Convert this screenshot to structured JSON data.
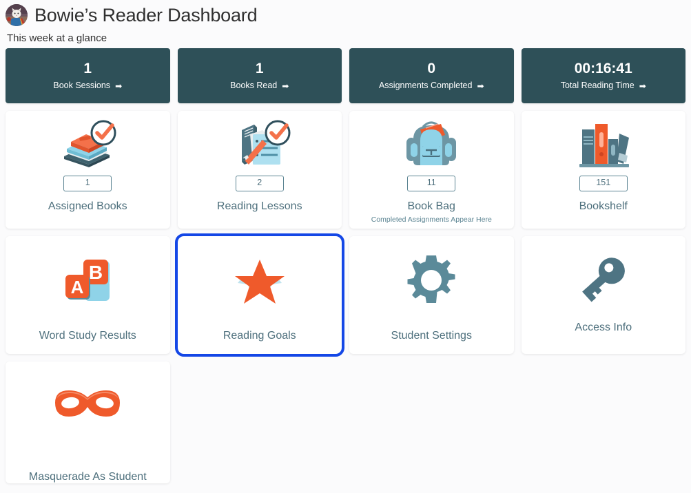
{
  "header": {
    "title": "Bowie’s Reader Dashboard",
    "subtitle": "This week at a glance",
    "avatar_name": "student-avatar"
  },
  "stats": [
    {
      "value": "1",
      "label": "Book Sessions",
      "arrow": "➡"
    },
    {
      "value": "1",
      "label": "Books Read",
      "arrow": "➡"
    },
    {
      "value": "0",
      "label": "Assignments Completed",
      "arrow": "➡"
    },
    {
      "value": "00:16:41",
      "label": "Total Reading Time",
      "arrow": "➡"
    }
  ],
  "tiles": [
    {
      "label": "Assigned Books",
      "badge": "1",
      "icon": "books-check-icon"
    },
    {
      "label": "Reading Lessons",
      "badge": "2",
      "icon": "lesson-checklist-icon"
    },
    {
      "label": "Book Bag",
      "badge": "11",
      "sub": "Completed Assignments Appear Here",
      "icon": "backpack-icon"
    },
    {
      "label": "Bookshelf",
      "badge": "151",
      "icon": "bookshelf-icon"
    },
    {
      "label": "Word Study Results",
      "icon": "abc-blocks-icon"
    },
    {
      "label": "Reading Goals",
      "icon": "star-icon",
      "focused": true
    },
    {
      "label": "Student Settings",
      "icon": "gear-icon"
    },
    {
      "label": "Access Info",
      "icon": "key-icon"
    },
    {
      "label": "Masquerade As Student",
      "icon": "mask-icon"
    }
  ],
  "colors": {
    "stat_card_bg": "#2e5058",
    "tile_label": "#4d6f7c",
    "accent_orange": "#ef5a2b",
    "accent_light_blue": "#85d0e3",
    "focus_ring": "#1447e6",
    "page_bg": "#fbfbfc"
  }
}
